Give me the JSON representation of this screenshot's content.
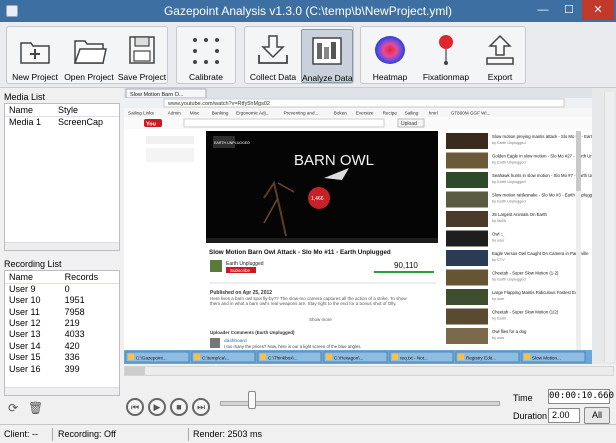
{
  "window": {
    "title": "Gazepoint Analysis v1.3.0 (C:\\temp\\b\\NewProject.yml)",
    "minimize": "—",
    "maximize": "☐",
    "close": "✕"
  },
  "toolbar": {
    "new_project": "New Project",
    "open_project": "Open Project",
    "save_project": "Save Project",
    "calibrate": "Calibrate",
    "collect_data": "Collect Data",
    "analyze_data": "Analyze Data",
    "heatmap": "Heatmap",
    "fixationmap": "Fixationmap",
    "export": "Export"
  },
  "media_list": {
    "header": "Media List",
    "col_name": "Name",
    "col_style": "Style",
    "rows": [
      {
        "name": "Media 1",
        "style": "ScreenCap"
      }
    ]
  },
  "recording_list": {
    "header": "Recording List",
    "col_name": "Name",
    "col_records": "Records",
    "rows": [
      {
        "name": "User 9",
        "records": "0"
      },
      {
        "name": "User 10",
        "records": "1951"
      },
      {
        "name": "User 11",
        "records": "7958"
      },
      {
        "name": "User 12",
        "records": "219"
      },
      {
        "name": "User 13",
        "records": "4033"
      },
      {
        "name": "User 14",
        "records": "420"
      },
      {
        "name": "User 15",
        "records": "336"
      },
      {
        "name": "User 16",
        "records": "399"
      }
    ]
  },
  "screen": {
    "tab_title": "Slow Motion Barn O...",
    "url": "www.youtube.com/watch?v=Rtfy5hMgs02",
    "bookmarks": [
      "Sailing Links",
      "Admin",
      "Misc",
      "Banking",
      "Ergonomic Adj...",
      "Preventing and...",
      "Boken",
      "Eversize",
      "Recipe",
      "Sailing",
      "hmrl",
      "GT800M GGF Wi..."
    ],
    "search_btn": "Upload",
    "video_title_overlay": "BARN OWL",
    "video_badge": "EARTH UNPLUGGED",
    "fixation_label": "1,466",
    "video_title": "Slow Motion Barn Owl Attack - Slo Mo #11 - Earth Unplugged",
    "channel": "Earth Unplugged",
    "subscribe": "Subscribe",
    "views": "90,110",
    "published": "Published on Apr 25, 2012",
    "desc": "Here lives a barn owl spot fly-by?? The slow-mo camera captures all the action of a strike. To show them and in what a barn owl's real weapons are. Stay right to the end for a bonus shot of Olly.",
    "show_more": "Show more",
    "comments_hdr": "Uploader Comments (Earth Unplugged)",
    "commenter": "dashboard",
    "comment": "I too many the prices? Now, here is our a light screen of the blue angles.",
    "related": [
      {
        "title": "Slow motion preying mantis attack - Slo Mo #2 - Earth Unplugged",
        "meta": "by Earth Unplugged"
      },
      {
        "title": "Golden Eagle in slow motion - Slo Mo #27 - Earth Unplugged",
        "meta": "by Earth Unplugged"
      },
      {
        "title": "Seahawk hunts in slow motion - Slo Mo #7 - Earth Unplugged",
        "meta": "by Earth Unplugged"
      },
      {
        "title": "Slow motion rattlesnake - Slo Mo #3 - Earth Unplugged",
        "meta": "by Earth Unplugged"
      },
      {
        "title": "25 Largest Animals On Earth",
        "meta": "by list25"
      },
      {
        "title": "Owl ::",
        "meta": "by user"
      },
      {
        "title": "Eagle Versus Owl Caught On Camera in Parksville",
        "meta": "by CTV"
      },
      {
        "title": "Cheetah - Super Slow Motion (1-2)",
        "meta": "by Earth Unplugged"
      },
      {
        "title": "Large Flapping Mantis Ridiculous Fastest Ever",
        "meta": "by user"
      },
      {
        "title": "Cheetah - Super Slow Motion (1/2)",
        "meta": "by Earth"
      },
      {
        "title": "Owl flies for a dog",
        "meta": "by user"
      }
    ],
    "taskbar": [
      "C:\\Gazepoint...",
      "C:\\temp\\ca\\...",
      "C:\\Thinkbox\\...",
      "C:\\Hexagon\\...",
      "req.txt - Not...",
      "Registry Edit...",
      "Slow Motion..."
    ]
  },
  "controls": {
    "time_label": "Time",
    "time_value": "00:00:10.660",
    "duration_label": "Duration",
    "duration_value": "2.00",
    "all_button": "All"
  },
  "status": {
    "client": "Client: --",
    "recording": "Recording: Off",
    "render": "Render: 2503 ms"
  },
  "colors": {
    "titlebar": "#3d6fa3",
    "heatmap_red": "#e0262b",
    "heatmap_blue": "#2d3fd0",
    "youtube_red": "#cc181e"
  },
  "icons": [
    "new-project-icon",
    "open-folder-icon",
    "save-icon",
    "calibrate-icon",
    "download-icon",
    "analyze-icon",
    "heatmap-icon",
    "fixation-icon",
    "export-icon"
  ]
}
